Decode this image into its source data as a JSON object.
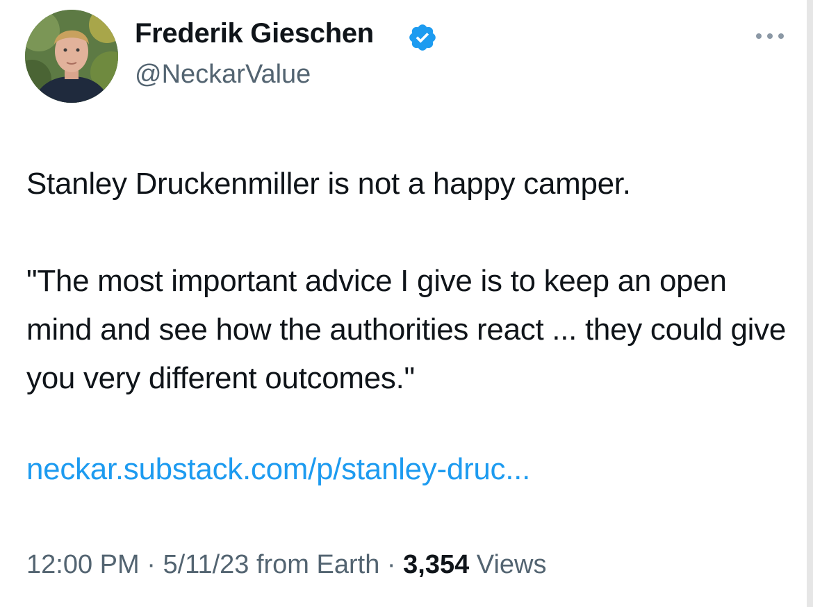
{
  "author": {
    "name": "Frederik Gieschen",
    "handle": "@NeckarValue",
    "verified": true
  },
  "tweet": {
    "text": "Stanley Druckenmiller is not a happy camper.\n\n\"The most important advice I give is to keep an open mind and see how the authorities react ... they could give you very different outcomes.\"",
    "link": "neckar.substack.com/p/stanley-druc..."
  },
  "meta": {
    "time": "12:00 PM",
    "separator": " · ",
    "date": "5/11/23",
    "source": " from Earth",
    "views_count": "3,354",
    "views_label": " Views"
  },
  "icons": {
    "verified": "verified-badge-icon",
    "more": "more-options-icon"
  },
  "colors": {
    "text": "#0f1419",
    "secondary": "#536471",
    "link": "#1d9bf0",
    "verified": "#1d9bf0"
  }
}
